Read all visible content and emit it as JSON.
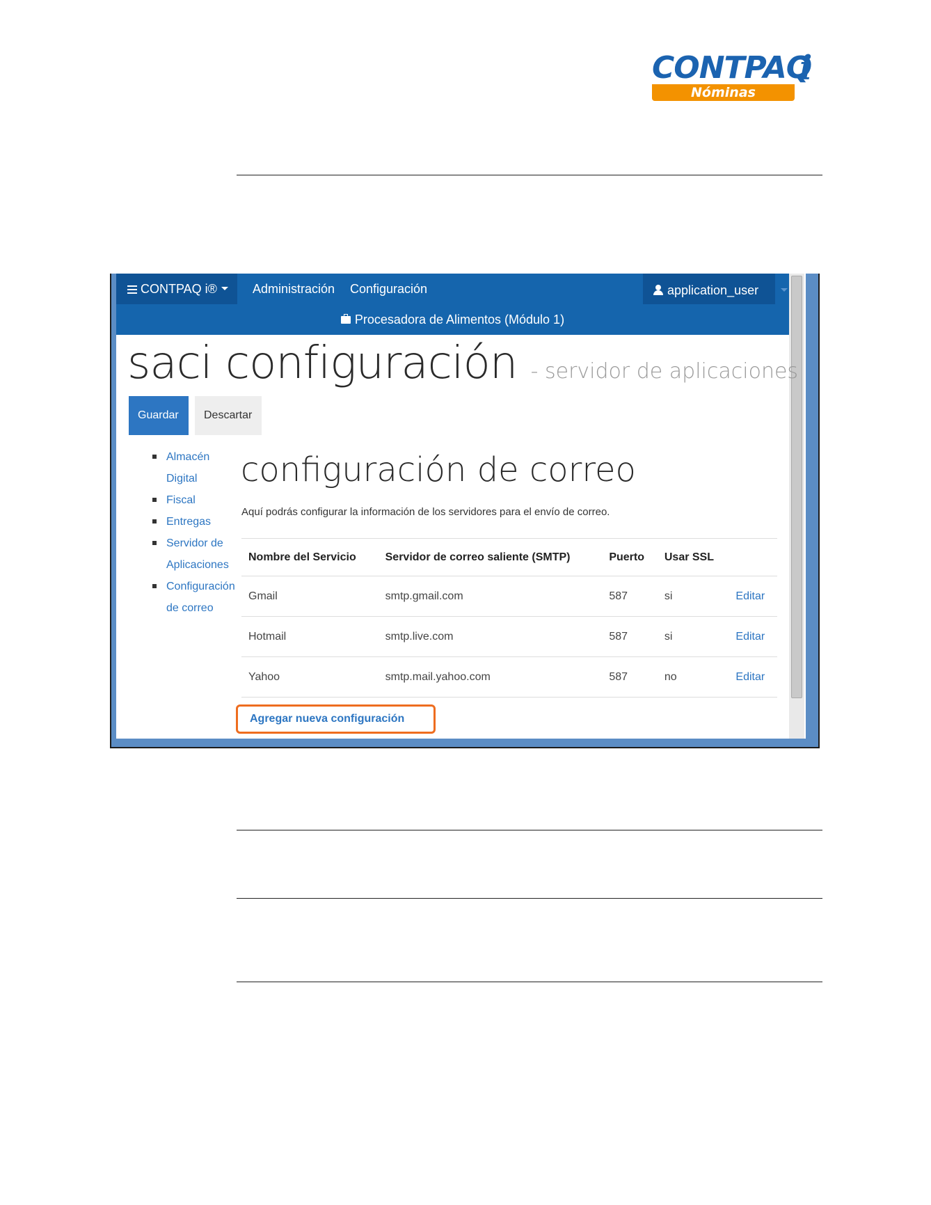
{
  "logo": {
    "word": "CONTPAQ",
    "i": "i",
    "product": "Nóminas"
  },
  "navbar": {
    "brand": "CONTPAQ i®",
    "admin": "Administración",
    "config": "Configuración",
    "user": "application_user",
    "company": "Procesadora de Alimentos (Módulo 1)"
  },
  "page": {
    "title": "saci configuración",
    "subtitle": "- servidor de aplicaciones",
    "save": "Guardar",
    "discard": "Descartar"
  },
  "sidenav": [
    "Almacén Digital",
    "Fiscal",
    "Entregas",
    "Servidor de Aplicaciones",
    "Configuración de correo"
  ],
  "section": {
    "title": "configuración de correo",
    "description": "Aquí podrás configurar la información de los servidores para el envío de correo.",
    "headers": [
      "Nombre del Servicio",
      "Servidor de correo saliente (SMTP)",
      "Puerto",
      "Usar SSL"
    ],
    "rows": [
      {
        "name": "Gmail",
        "smtp": "smtp.gmail.com",
        "port": "587",
        "ssl": "si",
        "action": "Editar"
      },
      {
        "name": "Hotmail",
        "smtp": "smtp.live.com",
        "port": "587",
        "ssl": "si",
        "action": "Editar"
      },
      {
        "name": "Yahoo",
        "smtp": "smtp.mail.yahoo.com",
        "port": "587",
        "ssl": "no",
        "action": "Editar"
      }
    ],
    "add": "Agregar nueva configuración"
  }
}
